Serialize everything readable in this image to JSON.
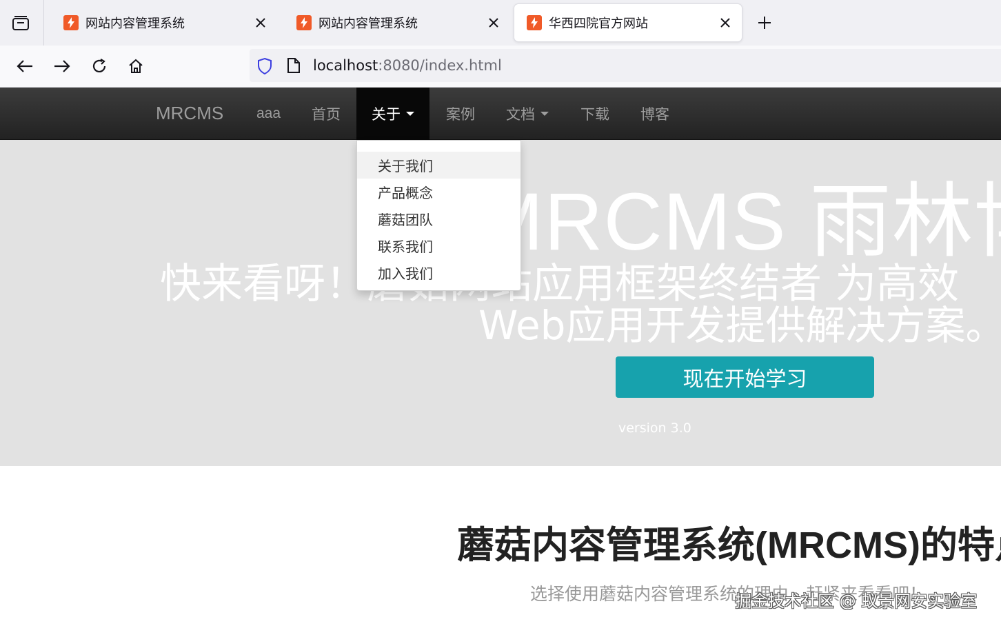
{
  "browser": {
    "tabs": [
      {
        "title": "网站内容管理系统",
        "active": false
      },
      {
        "title": "网站内容管理系统",
        "active": false
      },
      {
        "title": "华西四院官方网站",
        "active": true
      }
    ],
    "url_host": "localhost",
    "url_path": ":8080/index.html"
  },
  "site_nav": {
    "brand": "MRCMS",
    "items": [
      {
        "label": "aaa"
      },
      {
        "label": "首页"
      },
      {
        "label": "关于",
        "dropdown": true,
        "open": true
      },
      {
        "label": "案例"
      },
      {
        "label": "文档",
        "dropdown": true
      },
      {
        "label": "下载"
      },
      {
        "label": "博客"
      }
    ]
  },
  "dropdown": {
    "items": [
      "关于我们",
      "产品概念",
      "蘑菇团队",
      "联系我们",
      "加入我们"
    ]
  },
  "hero": {
    "title": "MRCMS 雨林博客",
    "line1": "快来看呀！蘑菇网站应用框架终结者 为高效",
    "line2": "Web应用开发提供解决方案。",
    "cta": "现在开始学习",
    "version": "version 3.0"
  },
  "features": {
    "title": "蘑菇内容管理系统(MRCMS)的特点",
    "subtitle": "选择使用蘑菇内容管理系统的理由，赶紧来看看吧！"
  },
  "watermark": "掘金技术社区 @ 蚁景网安实验室",
  "colors": {
    "favicon": "#f05a28",
    "cta": "#17a2ad",
    "navbar": "#222222",
    "hero_bg": "#e2e2e2"
  }
}
